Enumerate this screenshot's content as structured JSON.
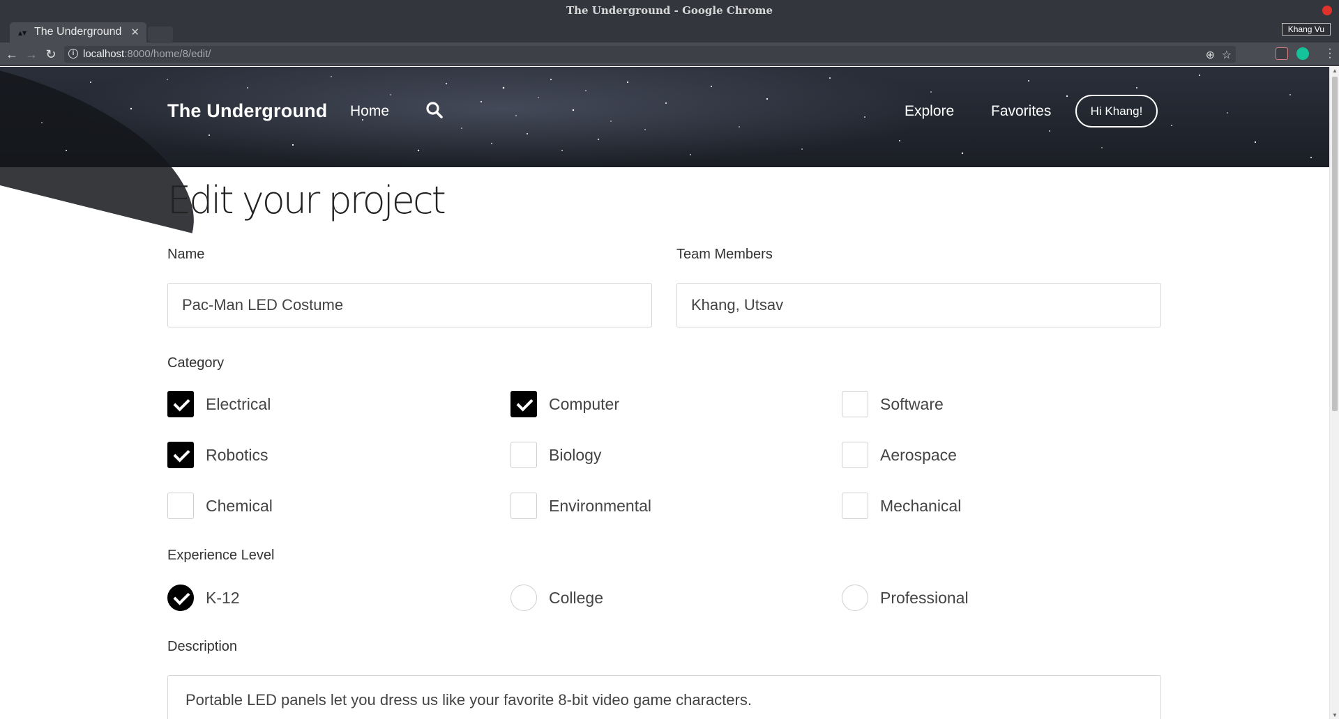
{
  "window": {
    "title": "The Underground - Google Chrome",
    "profile_name": "Khang Vu"
  },
  "tab": {
    "title": "The Underground",
    "favicon": "bowtie-icon"
  },
  "address_bar": {
    "host": "localhost",
    "path": ":8000/home/8/edit/"
  },
  "navbar": {
    "brand": "The Underground",
    "home": "Home",
    "explore": "Explore",
    "favorites": "Favorites",
    "greeting": "Hi Khang!"
  },
  "form": {
    "page_title": "Edit your project",
    "name_label": "Name",
    "name_value": "Pac-Man LED Costume",
    "team_label": "Team Members",
    "team_value": "Khang, Utsav",
    "category_label": "Category",
    "categories": [
      {
        "label": "Electrical",
        "checked": true
      },
      {
        "label": "Computer",
        "checked": true
      },
      {
        "label": "Software",
        "checked": false
      },
      {
        "label": "Robotics",
        "checked": true
      },
      {
        "label": "Biology",
        "checked": false
      },
      {
        "label": "Aerospace",
        "checked": false
      },
      {
        "label": "Chemical",
        "checked": false
      },
      {
        "label": "Environmental",
        "checked": false
      },
      {
        "label": "Mechanical",
        "checked": false
      }
    ],
    "experience_label": "Experience Level",
    "experience_levels": [
      {
        "label": "K-12",
        "selected": true
      },
      {
        "label": "College",
        "selected": false
      },
      {
        "label": "Professional",
        "selected": false
      }
    ],
    "description_label": "Description",
    "description_value": "Portable LED panels let you dress us like your favorite 8-bit video game characters."
  },
  "colors": {
    "chrome_dark": "#33363d",
    "checked_fill": "#000000",
    "close_dot": "#e1322c",
    "grammarly": "#15c39a"
  }
}
